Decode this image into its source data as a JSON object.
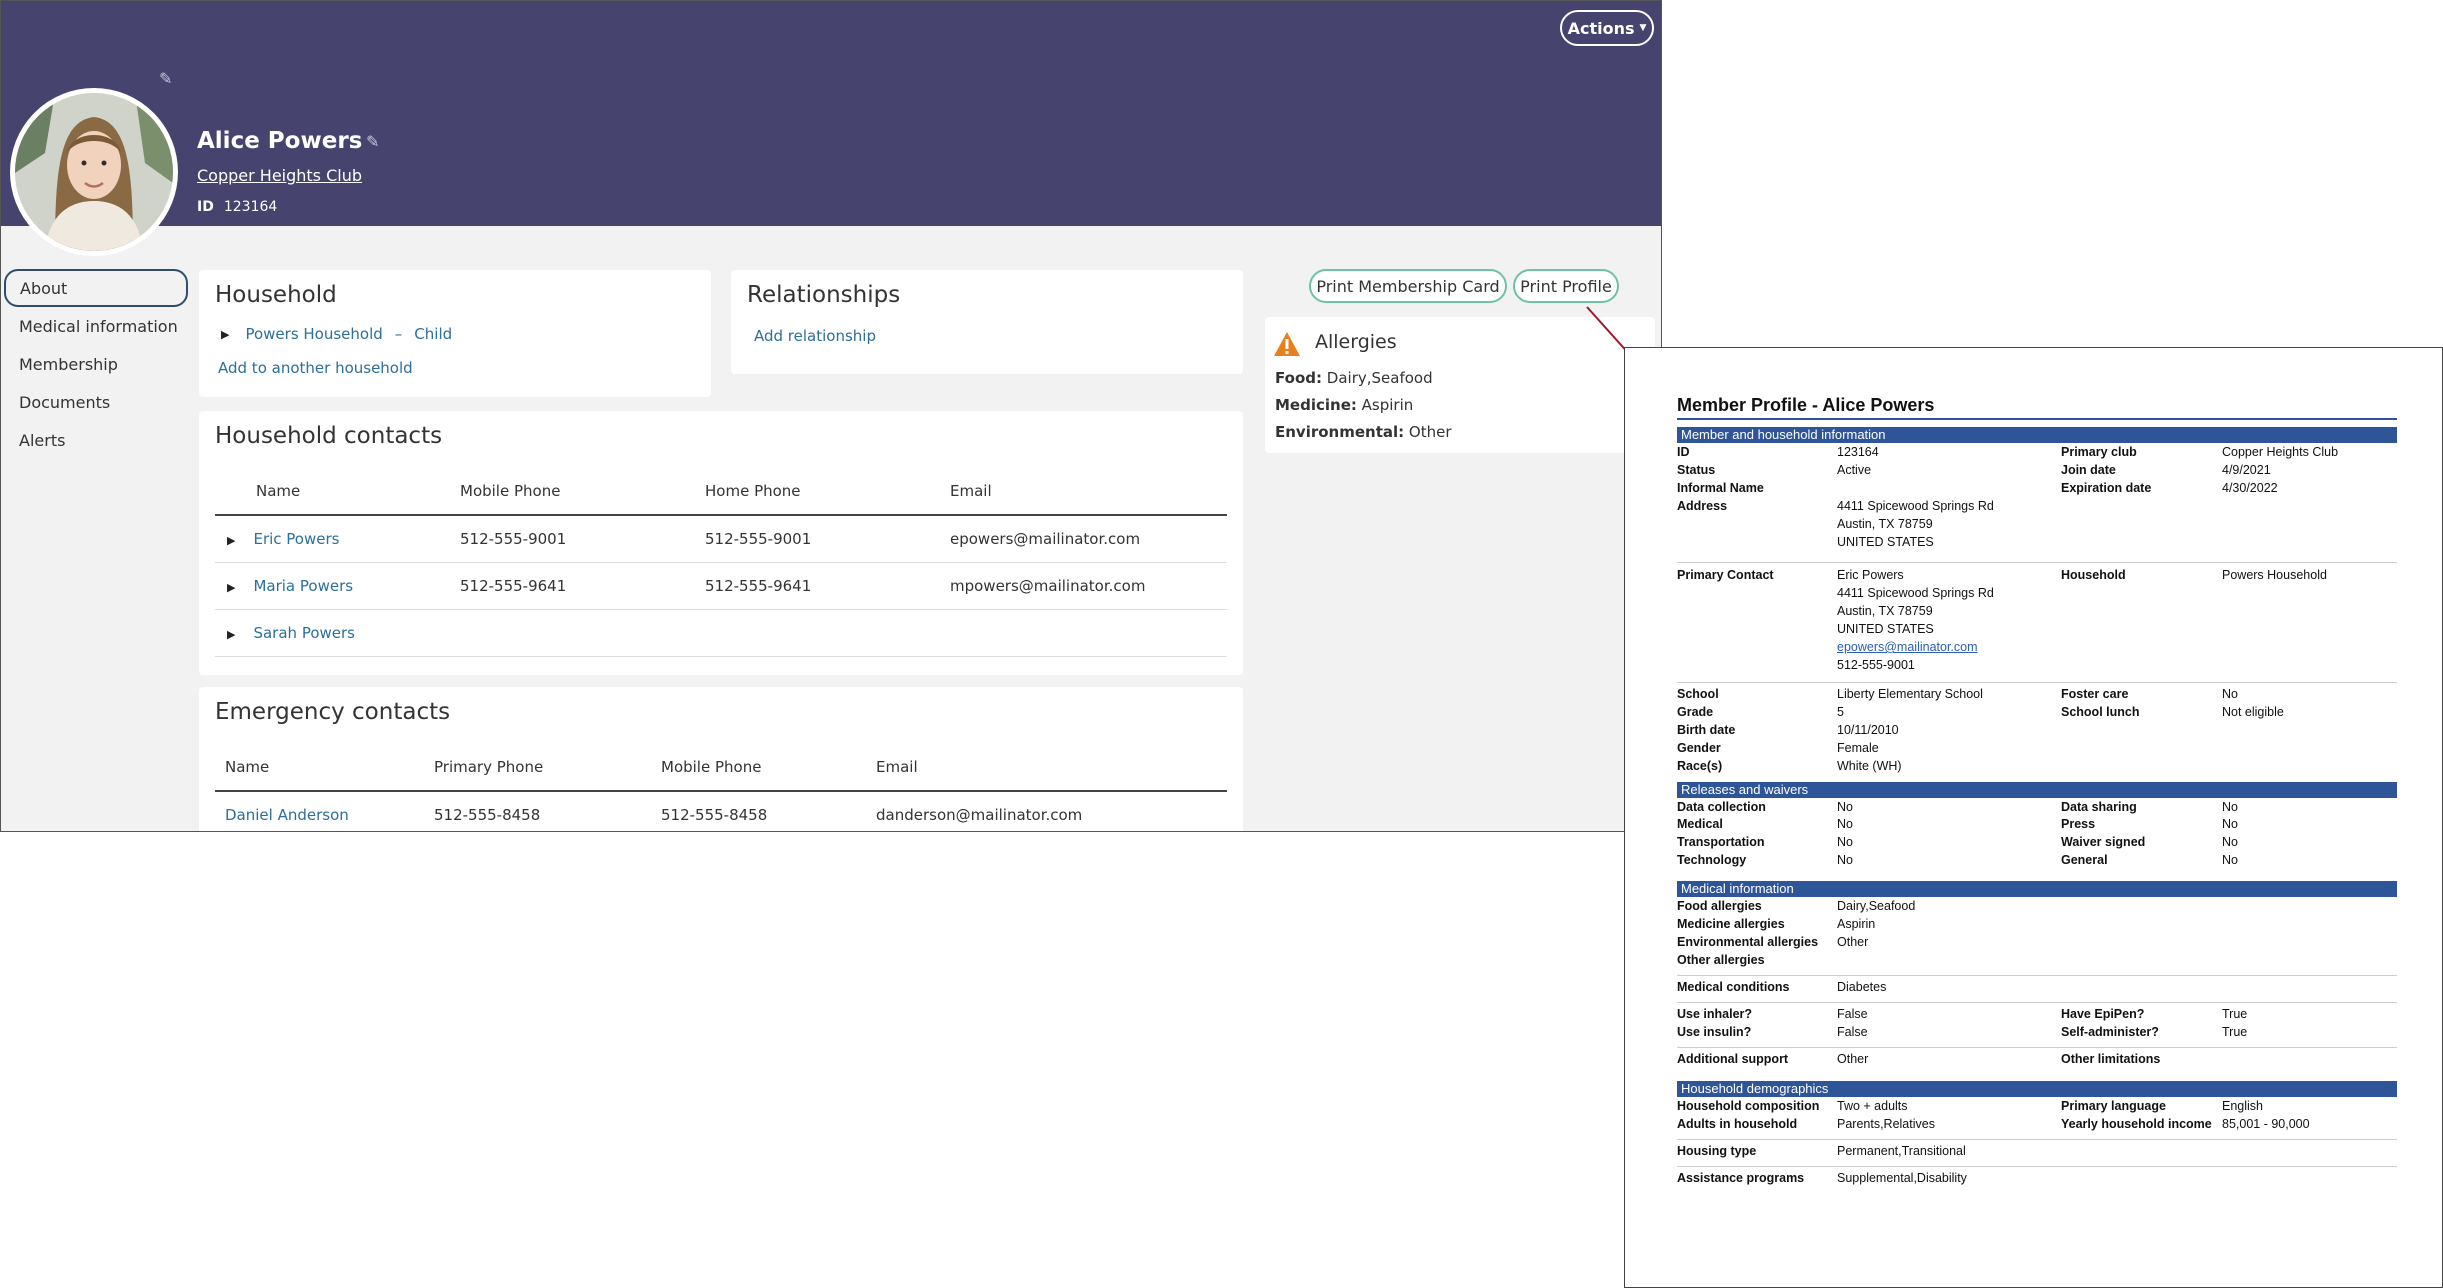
{
  "header": {
    "actions_label": "Actions",
    "member_name": "Alice Powers",
    "club_name": "Copper Heights Club",
    "id_label": "ID",
    "id_value": "123164",
    "color": "#47436f"
  },
  "sidebar": {
    "items": [
      {
        "label": "About",
        "active": true
      },
      {
        "label": "Medical information"
      },
      {
        "label": "Membership"
      },
      {
        "label": "Documents"
      },
      {
        "label": "Alerts"
      }
    ]
  },
  "household": {
    "title": "Household",
    "entry_name": "Powers Household",
    "entry_sep": "–",
    "entry_role": "Child",
    "add_link": "Add to another household"
  },
  "relationships": {
    "title": "Relationships",
    "add_link": "Add relationship"
  },
  "buttons": {
    "print_card": "Print Membership Card",
    "print_profile": "Print Profile"
  },
  "allergies": {
    "title": "Allergies",
    "food_label": "Food:",
    "food_value": "Dairy,Seafood",
    "medicine_label": "Medicine:",
    "medicine_value": "Aspirin",
    "environmental_label": "Environmental:",
    "environmental_value": "Other"
  },
  "household_contacts": {
    "title": "Household contacts",
    "columns": [
      "Name",
      "Mobile Phone",
      "Home Phone",
      "Email"
    ],
    "rows": [
      {
        "name": "Eric Powers",
        "mobile": "512-555-9001",
        "home": "512-555-9001",
        "email": "epowers@mailinator.com"
      },
      {
        "name": "Maria Powers",
        "mobile": "512-555-9641",
        "home": "512-555-9641",
        "email": "mpowers@mailinator.com"
      },
      {
        "name": "Sarah Powers",
        "mobile": "",
        "home": "",
        "email": ""
      }
    ]
  },
  "emergency_contacts": {
    "title": "Emergency contacts",
    "columns": [
      "Name",
      "Primary Phone",
      "Mobile Phone",
      "Email"
    ],
    "rows": [
      {
        "name": "Daniel Anderson",
        "primary": "512-555-8458",
        "mobile": "512-555-8458",
        "email": "danderson@mailinator.com"
      }
    ]
  },
  "printout": {
    "title": "Member Profile - Alice Powers",
    "sections": {
      "member": "Member and household information",
      "releases": "Releases and waivers",
      "medical": "Medical information",
      "demographics": "Household demographics"
    },
    "member": {
      "id_l": "ID",
      "id_v": "123164",
      "status_l": "Status",
      "status_v": "Active",
      "informal_l": "Informal Name",
      "address_l": "Address",
      "address_1": "4411 Spicewood Springs Rd",
      "address_2": "Austin, TX 78759",
      "address_3": "UNITED STATES",
      "club_l": "Primary club",
      "club_v": "Copper Heights Club",
      "join_l": "Join date",
      "join_v": "4/9/2021",
      "exp_l": "Expiration date",
      "exp_v": "4/30/2022",
      "contact_l": "Primary Contact",
      "contact_1": "Eric Powers",
      "contact_2": "4411 Spicewood Springs Rd",
      "contact_3": "Austin, TX 78759",
      "contact_4": "UNITED STATES",
      "contact_email": "epowers@mailinator.com",
      "contact_phone": "512-555-9001",
      "household_l": "Household",
      "household_v": "Powers Household",
      "school_l": "School",
      "school_v": "Liberty Elementary School",
      "grade_l": "Grade",
      "grade_v": "5",
      "birth_l": "Birth date",
      "birth_v": "10/11/2010",
      "gender_l": "Gender",
      "gender_v": "Female",
      "race_l": "Race(s)",
      "race_v": "White (WH)",
      "foster_l": "Foster care",
      "foster_v": "No",
      "lunch_l": "School lunch",
      "lunch_v": "Not eligible"
    },
    "releases": {
      "data_coll_l": "Data collection",
      "data_coll_v": "No",
      "medical_l": "Medical",
      "medical_v": "No",
      "transport_l": "Transportation",
      "transport_v": "No",
      "tech_l": "Technology",
      "tech_v": "No",
      "data_share_l": "Data sharing",
      "data_share_v": "No",
      "press_l": "Press",
      "press_v": "No",
      "waiver_l": "Waiver signed",
      "waiver_v": "No",
      "general_l": "General",
      "general_v": "No"
    },
    "medical": {
      "food_l": "Food allergies",
      "food_v": "Dairy,Seafood",
      "medicine_l": "Medicine allergies",
      "medicine_v": "Aspirin",
      "env_l": "Environmental allergies",
      "env_v": "Other",
      "other_l": "Other allergies",
      "conditions_l": "Medical conditions",
      "conditions_v": "Diabetes",
      "inhaler_l": "Use inhaler?",
      "inhaler_v": "False",
      "insulin_l": "Use insulin?",
      "insulin_v": "False",
      "epipen_l": "Have EpiPen?",
      "epipen_v": "True",
      "selfadmin_l": "Self-administer?",
      "selfadmin_v": "True",
      "support_l": "Additional support",
      "support_v": "Other",
      "limitations_l": "Other limitations"
    },
    "demographics": {
      "composition_l": "Household composition",
      "composition_v": "Two + adults",
      "adults_l": "Adults in household",
      "adults_v": "Parents,Relatives",
      "language_l": "Primary language",
      "language_v": "English",
      "income_l": "Yearly household income",
      "income_v": "85,001 - 90,000",
      "housing_l": "Housing type",
      "housing_v": "Permanent,Transitional",
      "assistance_l": "Assistance programs",
      "assistance_v": "Supplemental,Disability"
    }
  }
}
